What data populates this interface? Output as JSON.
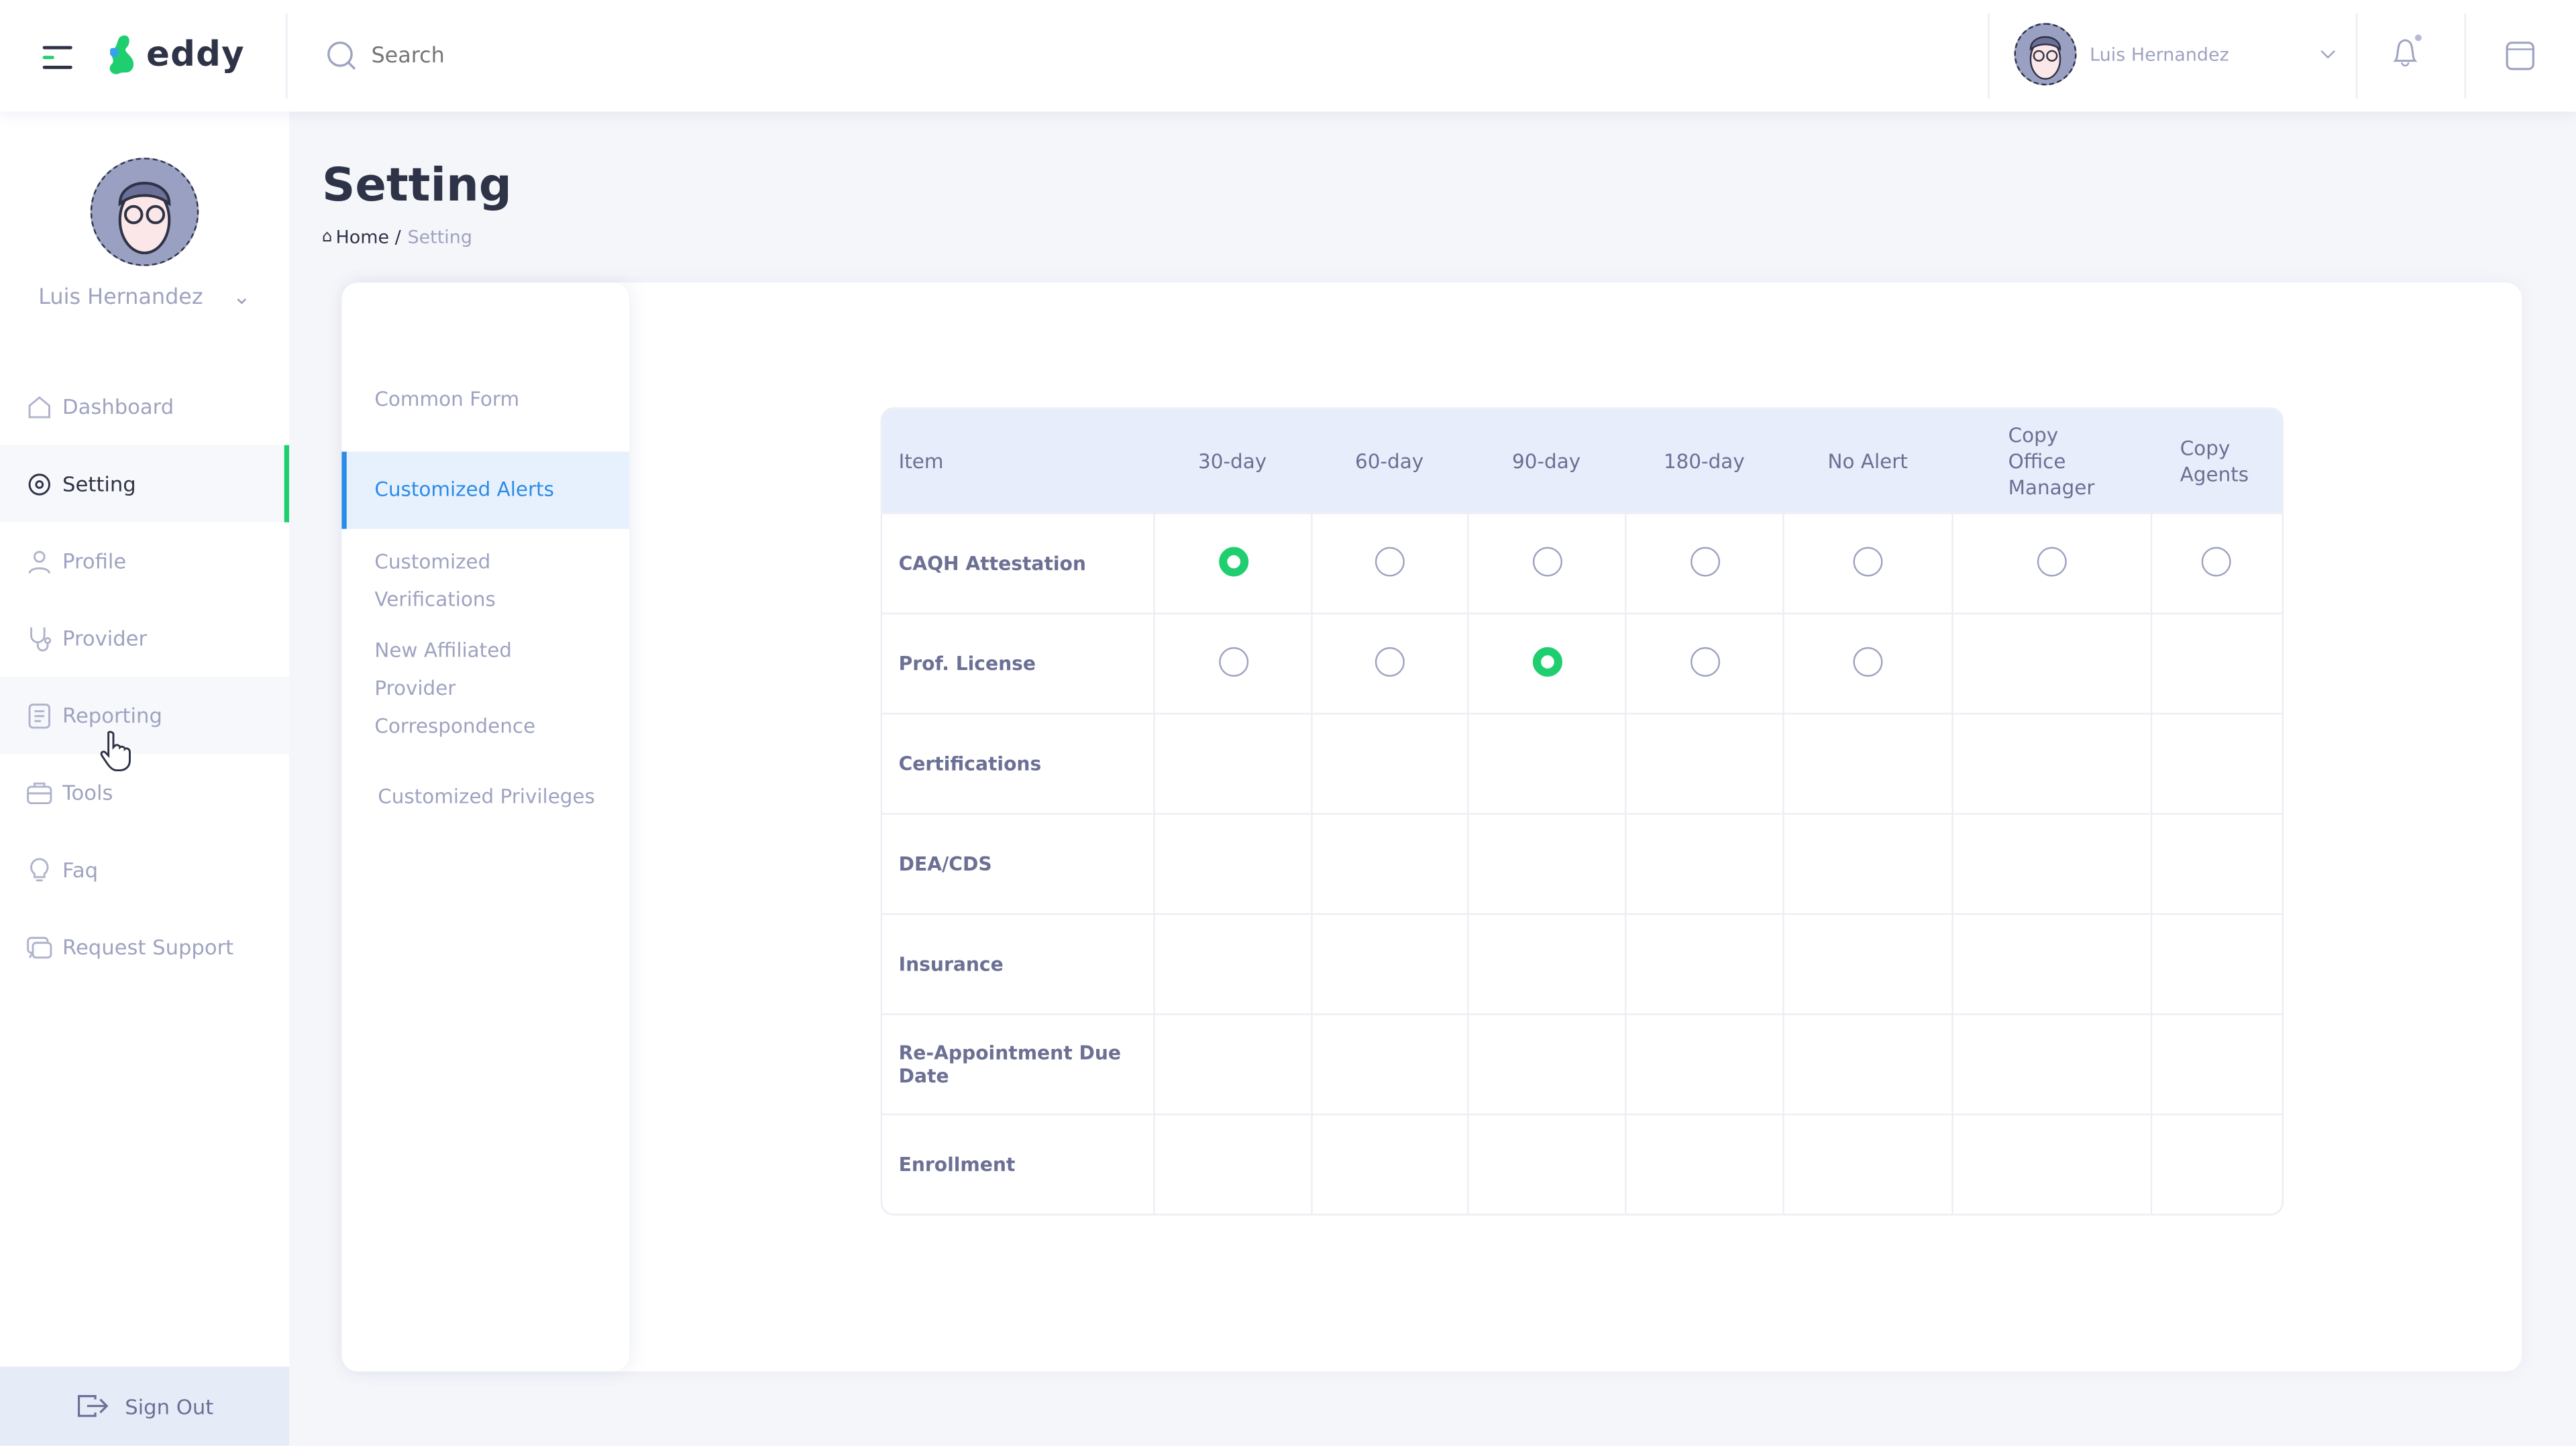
{
  "app": {
    "brand": "eddy",
    "accent": "#1fcf6f",
    "link": "#2b8be8"
  },
  "topbar": {
    "search_placeholder": "Search",
    "user_name": "Luis Hernandez"
  },
  "sidebar": {
    "user_name": "Luis Hernandez",
    "items": [
      {
        "label": "Dashboard",
        "icon": "home-icon"
      },
      {
        "label": "Setting",
        "icon": "gear-icon",
        "active": true
      },
      {
        "label": "Profile",
        "icon": "user-icon"
      },
      {
        "label": "Provider",
        "icon": "stethoscope-icon"
      },
      {
        "label": "Reporting",
        "icon": "report-icon"
      },
      {
        "label": "Tools",
        "icon": "toolbox-icon"
      },
      {
        "label": "Faq",
        "icon": "bulb-icon"
      },
      {
        "label": "Request Support",
        "icon": "support-icon"
      }
    ],
    "sign_out": "Sign Out"
  },
  "page": {
    "title": "Setting",
    "breadcrumb": {
      "home": "Home",
      "sep": "/",
      "current": "Setting"
    }
  },
  "tabs": [
    "Common Form",
    "Customized Alerts",
    "Customized Verifications",
    "New Affiliated Provider Correspondence",
    "Customized Privileges"
  ],
  "active_tab": 1,
  "table": {
    "headers": [
      "Item",
      "30-day",
      "60-day",
      "90-day",
      "180-day",
      "No Alert",
      "Copy Office Manager",
      "Copy Agents"
    ],
    "rows": [
      {
        "item": "CAQH Attestation",
        "options": 7,
        "selected": 0
      },
      {
        "item": "Prof. License",
        "options": 5,
        "selected": 2
      },
      {
        "item": "Certifications",
        "options": 0
      },
      {
        "item": "DEA/CDS",
        "options": 0
      },
      {
        "item": "Insurance",
        "options": 0
      },
      {
        "item": "Re-Appointment Due Date",
        "options": 0
      },
      {
        "item": "Enrollment",
        "options": 0
      }
    ]
  }
}
